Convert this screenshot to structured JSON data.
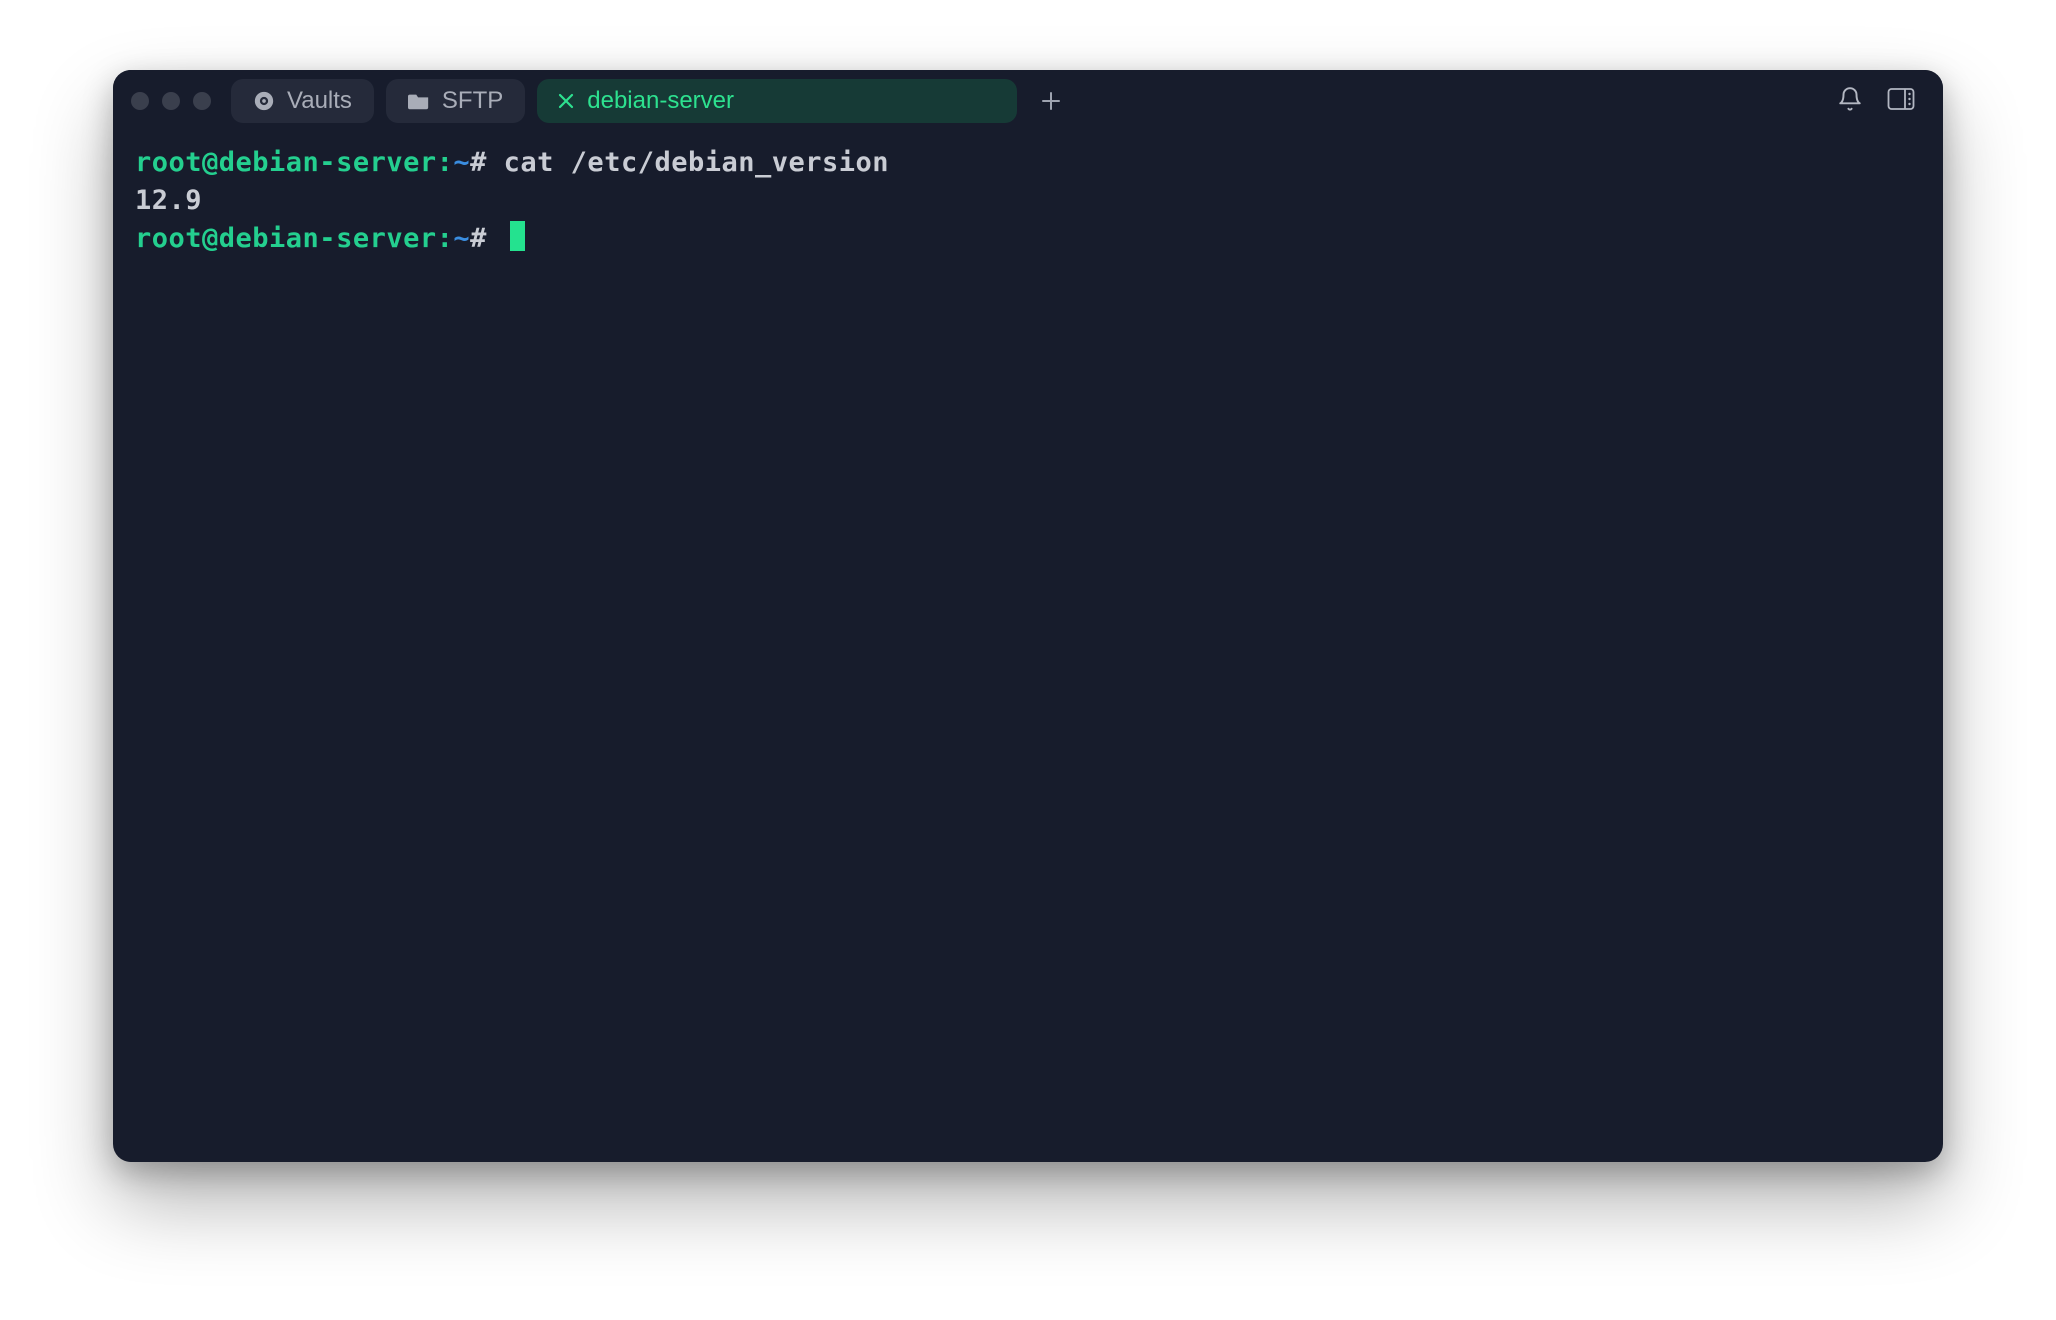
{
  "tabs": {
    "vaults": {
      "label": "Vaults"
    },
    "sftp": {
      "label": "SFTP"
    },
    "active": {
      "label": "debian-server"
    }
  },
  "terminal": {
    "line1": {
      "prompt_userhost": "root@debian-server:",
      "prompt_tilde": "~",
      "prompt_hash": "#",
      "command": "cat /etc/debian_version"
    },
    "output1": "12.9",
    "line2": {
      "prompt_userhost": "root@debian-server:",
      "prompt_tilde": "~",
      "prompt_hash": "#"
    }
  }
}
